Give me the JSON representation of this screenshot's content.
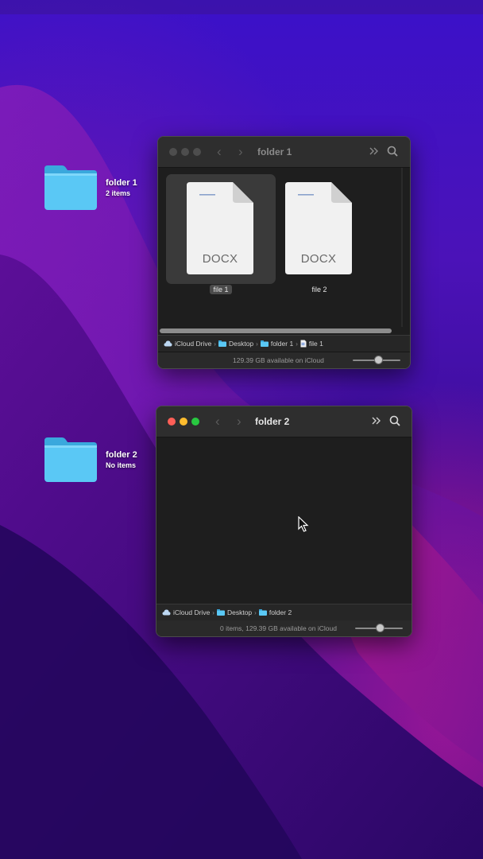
{
  "desktop": {
    "folders": [
      {
        "name": "folder 1",
        "info": "2 items"
      },
      {
        "name": "folder 2",
        "info": "No items"
      }
    ]
  },
  "window1": {
    "title": "folder 1",
    "active": false,
    "files": [
      {
        "name": "file 1",
        "type": "DOCX",
        "selected": true
      },
      {
        "name": "file 2",
        "type": "DOCX",
        "selected": false
      }
    ],
    "path": [
      "iCloud Drive",
      "Desktop",
      "folder 1",
      "file 1"
    ],
    "status": "129.39 GB available on iCloud"
  },
  "window2": {
    "title": "folder 2",
    "active": true,
    "path": [
      "iCloud Drive",
      "Desktop",
      "folder 2"
    ],
    "status": "0 items, 129.39 GB available on iCloud"
  },
  "colors": {
    "close": "#ff5f57",
    "minimize": "#febc2e",
    "zoom": "#28c840",
    "inactive_light": "#4d4d4d",
    "folder_blue": "#4fc3f7"
  },
  "icons": [
    "back-arrow-icon",
    "forward-arrow-icon",
    "more-chevron-icon",
    "search-icon",
    "icloud-icon",
    "folder-icon",
    "document-icon",
    "cursor-icon"
  ]
}
